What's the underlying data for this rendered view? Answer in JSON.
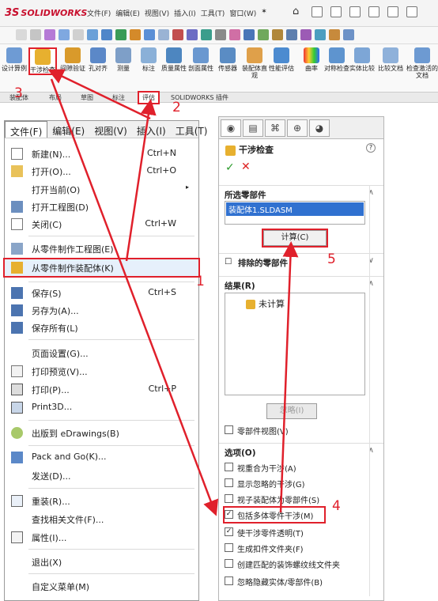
{
  "app": {
    "logo": "SOLIDWORKS",
    "logo_prefix": "3S",
    "menus": [
      "文件(F)",
      "编辑(E)",
      "视图(V)",
      "插入(I)",
      "工具(T)",
      "窗口(W)",
      "✶"
    ]
  },
  "ribbon": {
    "buttons": [
      {
        "label": "设计算例"
      },
      {
        "label": "干涉检查"
      },
      {
        "label": "间隙验证"
      },
      {
        "label": "孔对齐"
      },
      {
        "label": "测量"
      },
      {
        "label": "标注"
      },
      {
        "label": "质量属性"
      },
      {
        "label": "剖面属性"
      },
      {
        "label": "传感器"
      },
      {
        "label": "装配体直观"
      },
      {
        "label": "性能评估"
      },
      {
        "label": "曲率"
      },
      {
        "label": "对称检查"
      },
      {
        "label": "实体比较"
      },
      {
        "label": "比较文档"
      },
      {
        "label": "检查激活的文档"
      }
    ],
    "tabs": [
      "装配体",
      "布局",
      "草图",
      "标注",
      "评估",
      "SOLIDWORKS 插件"
    ]
  },
  "file_menu": {
    "bar": [
      "文件(F)",
      "编辑(E)",
      "视图(V)",
      "插入(I)",
      "工具(T)"
    ],
    "items": [
      {
        "label": "新建(N)...",
        "shortcut": "Ctrl+N"
      },
      {
        "label": "打开(O)...",
        "shortcut": "Ctrl+O"
      },
      {
        "label": "打开当前(O)",
        "arrow": "▸"
      },
      {
        "label": "打开工程图(D)"
      },
      {
        "label": "关闭(C)",
        "shortcut": "Ctrl+W"
      },
      {
        "label": "从零件制作工程图(E)"
      },
      {
        "label": "从零件制作装配体(K)"
      },
      {
        "label": "保存(S)",
        "shortcut": "Ctrl+S"
      },
      {
        "label": "另存为(A)..."
      },
      {
        "label": "保存所有(L)"
      },
      {
        "label": "页面设置(G)..."
      },
      {
        "label": "打印预览(V)..."
      },
      {
        "label": "打印(P)...",
        "shortcut": "Ctrl+P"
      },
      {
        "label": "Print3D..."
      },
      {
        "label": "出版到 eDrawings(B)"
      },
      {
        "label": "Pack and Go(K)..."
      },
      {
        "label": "发送(D)..."
      },
      {
        "label": "重装(R)..."
      },
      {
        "label": "查找相关文件(F)..."
      },
      {
        "label": "属性(I)..."
      },
      {
        "label": "退出(X)"
      },
      {
        "label": "自定义菜单(M)"
      }
    ]
  },
  "property_manager": {
    "tabs": [
      "◉",
      "▤",
      "⌘",
      "⊕",
      "◕"
    ],
    "title": "干涉检查",
    "help": "?",
    "ok": "✓",
    "cancel": "✕",
    "selected_section": "所选零部件",
    "selected_item": "装配体1.SLDASM",
    "calculate": "计算(C)",
    "excluded_section": "排除的零部件",
    "results_section": "结果(R)",
    "result_item": "未计算",
    "ignore": "忽略(I)",
    "component_view": "零部件视图(V)",
    "options_section": "选项(O)",
    "options": [
      {
        "label": "视重合为干涉(A)",
        "checked": false
      },
      {
        "label": "显示忽略的干涉(G)",
        "checked": false
      },
      {
        "label": "视子装配体为零部件(S)",
        "checked": false
      },
      {
        "label": "包括多体零件干涉(M)",
        "checked": true
      },
      {
        "label": "使干涉零件透明(T)",
        "checked": true
      },
      {
        "label": "生成扣件文件夹(F)",
        "checked": false
      },
      {
        "label": "创建匹配的装饰螺纹线文件夹",
        "checked": false
      },
      {
        "label": "忽略隐藏实体/零部件(B)",
        "checked": false
      }
    ],
    "check_mark": "☑",
    "uncheck_mark": "☐",
    "collapse": "∧",
    "expand": "∨"
  },
  "annotations": [
    "1",
    "2",
    "3",
    "4",
    "5"
  ],
  "colors": {
    "highlight": "#e0202b",
    "selection": "#3071d0"
  }
}
